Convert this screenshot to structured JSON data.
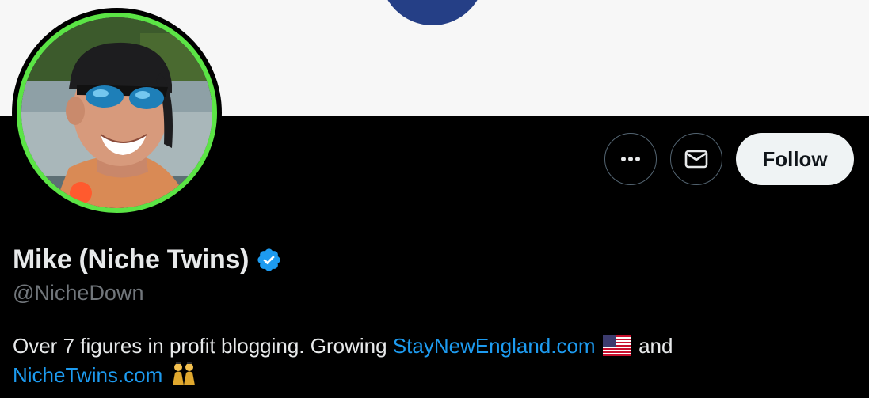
{
  "banner": {
    "background": "#f7f7f7",
    "logo_color": "#253f86"
  },
  "avatar": {
    "ring_color": "#5be445",
    "icon": "profile-photo"
  },
  "actions": {
    "more_icon": "more-dots-icon",
    "message_icon": "envelope-icon",
    "follow_label": "Follow"
  },
  "profile": {
    "name": "Mike (Niche Twins)",
    "verified_icon": "verified-badge-icon",
    "verified_color": "#1d9bf0",
    "handle": "@NicheDown"
  },
  "bio": {
    "text_1": "Over 7 figures in profit blogging. Growing ",
    "link_1": "StayNewEngland.com",
    "emoji_1": "us-flag-icon",
    "text_2": " and",
    "link_2": "NicheTwins.com",
    "emoji_2": "twins-icon",
    "link_color": "#1d9bf0"
  }
}
